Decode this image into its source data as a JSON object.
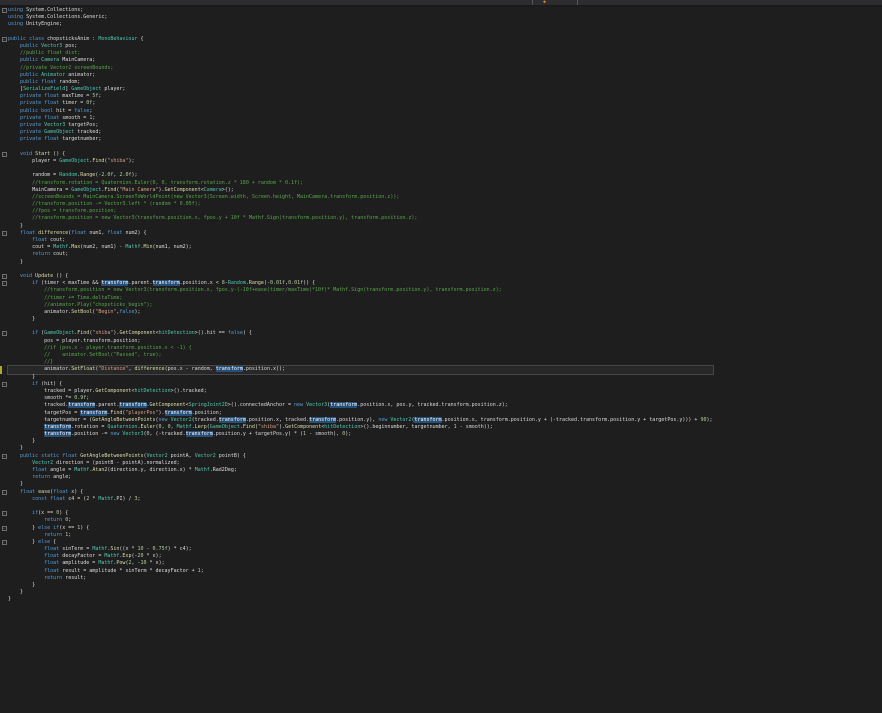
{
  "editor": {
    "language": "C#",
    "lines": [
      "using System.Collections;",
      "using System.Collections.Generic;",
      "using UnityEngine;",
      "",
      "public class chopsticksAnim : MonoBehaviour {",
      "    public Vector3 pos;",
      "    //public float dist;",
      "    public Camera MainCamera;",
      "    //private Vector2 screenBounds;",
      "    public Animator animator;",
      "    public float random;",
      "    [SerializeField] GameObject player;",
      "    private float maxTime = 5f;",
      "    private float timer = 0f;",
      "    public bool hit = false;",
      "    private float smooth = 1;",
      "    private Vector3 targetPos;",
      "    private GameObject tracked;",
      "    private float targetnumber;",
      "",
      "    void Start () {",
      "        player = GameObject.Find(\"shiba\");",
      "",
      "        random = Random.Range(-2.0f, 2.0f);",
      "        //transform.rotation = Quaternion.Euler(0, 0, transform.rotation.z * 180 + random * 0.1f);",
      "        MainCamera = GameObject.Find(\"Main Camera\").GetComponent<Camera>();",
      "        //screenBounds = MainCamera.ScreenToWorldPoint(new Vector3(Screen.width, Screen.height, MainCamera.transform.position.z));",
      "        //transform.position -= Vector3.left * (random * 0.05f);",
      "        //fpos = transform.position;",
      "        //transform.position = new Vector3(transform.position.x, fpos.y + 10f * Mathf.Sign(transform.position.y), transform.position.z);",
      "    }",
      "    float difference(float num1, float num2) {",
      "        float cout;",
      "        cout = Mathf.Max(num2, num1) - Mathf.Min(num1, num2);",
      "        return cout;",
      "    }",
      "",
      "    void Update () {",
      "        if (timer < maxTime && transform.parent.transform.position.x < 8-Random.Range(-0.01f,0.01f)) {",
      "            //transform.position = new Vector3(transform.position.x, fpos.y-(-10f+ease(timer/maxTime)*10f)* Mathf.Sign(transform.position.y), transform.position.z);",
      "            //timer += Time.deltaTime;",
      "            //animator.Play(\"chopsticks_begin\");",
      "            animator.SetBool(\"Begin\",false);",
      "        }",
      "",
      "        if (GameObject.Find(\"shiba\").GetComponent<hitDetection>().hit == false) {",
      "            pos = player.transform.position;",
      "            //if (pos.x - player.transform.position.x < -1) {",
      "            //    animator.SetBool(\"Passed\", true);",
      "            //}",
      "            animator.SetFloat(\"Distance\", difference(pos.x - random, transform.position.x));",
      "        }",
      "        if (hit) {",
      "            tracked = player.GetComponent<hitDetection>().tracked;",
      "            smooth *= 0.9f;",
      "            tracked.transform.parent.transform.GetComponent<SpringJoint2D>().connectedAnchor = new Vector3(transform.position.x, pos.y, tracked.transform.position.z);",
      "            targetPos = transform.Find(\"playerPos\").transform.position;",
      "            targetnumber = (GetAngleBetweenPoints(new Vector2(tracked.transform.position.x, tracked.transform.position.y), new Vector2(transform.position.x, transform.position.y + (-tracked.transform.position.y + targetPos.y))) + 90);",
      "            transform.rotation = Quaternion.Euler(0, 0, Mathf.Lerp(GameObject.Find(\"shiba\").GetComponent<hitDetection>().beginnumber, targetnumber, 1 - smooth));",
      "            transform.position -= new Vector3(0, (-tracked.transform.position.y + targetPos.y) * (1 - smooth), 0);",
      "        }",
      "    }",
      "    public static float GetAngleBetweenPoints(Vector2 pointA, Vector2 pointB) {",
      "        Vector2 direction = (pointB - pointA).normalized;",
      "        float angle = Mathf.Atan2(direction.y, direction.x) * Mathf.Rad2Deg;",
      "        return angle;",
      "    }",
      "    float ease(float x) {",
      "        const float c4 = (2 * Mathf.PI) / 3;",
      "",
      "        if(x == 0) {",
      "            return 0;",
      "        } else if(x == 1) {",
      "            return 1;",
      "        } else {",
      "            float sinTerm = Mathf.Sin((x * 10 - 0.75f) * c4);",
      "            float decayFactor = Mathf.Exp(-20 * x);",
      "            float amplitude = Mathf.Pow(2, -10 * x);",
      "            float result = amplitude * sinTerm * decayFactor + 1;",
      "            return result;",
      "        }",
      "    }",
      "}"
    ]
  },
  "colors": {
    "background": "#1e1e1e",
    "keyword": "#569cd6",
    "type": "#4ec9b0",
    "string": "#d69d85",
    "comment": "#57a64a",
    "number": "#b5cea8",
    "method": "#dcdcaa",
    "highlight": "#264f78"
  },
  "icons": {
    "top_marker": "warning-icon",
    "fold": "collapse-icon"
  }
}
